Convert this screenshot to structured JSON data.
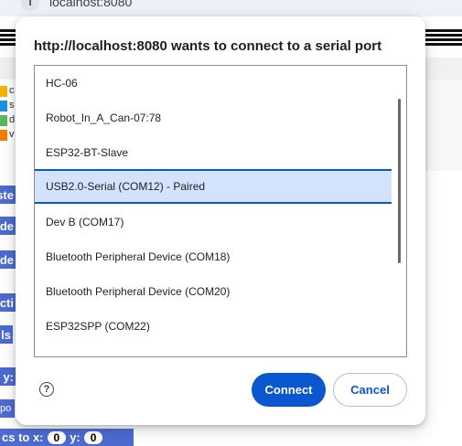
{
  "browser": {
    "address": "localhost:8080",
    "info_icon": "info-icon"
  },
  "background": {
    "legend": [
      {
        "letter": "c",
        "color": "#f4b400"
      },
      {
        "letter": "s",
        "color": "#1e90e0"
      },
      {
        "letter": "d",
        "color": "#5cb85c"
      },
      {
        "letter": "v",
        "color": "#f57c00"
      }
    ],
    "blocks": [
      "ste",
      "de",
      "de",
      "cti",
      "ls",
      "y:",
      "po"
    ],
    "bottom_block": {
      "label": "cs to x:",
      "x_value": "0",
      "y_label": "y:",
      "y_value": "0"
    },
    "block_color": "#4c6bd3"
  },
  "dialog": {
    "title": "http://localhost:8080 wants to connect to a serial port",
    "ports": [
      {
        "label": "HC-06",
        "selected": false
      },
      {
        "label": "Robot_In_A_Can-07:78",
        "selected": false
      },
      {
        "label": "ESP32-BT-Slave",
        "selected": false
      },
      {
        "label": "USB2.0-Serial (COM12) - Paired",
        "selected": true
      },
      {
        "label": "Dev B (COM17)",
        "selected": false
      },
      {
        "label": "Bluetooth Peripheral Device (COM18)",
        "selected": false
      },
      {
        "label": "Bluetooth Peripheral Device (COM20)",
        "selected": false
      },
      {
        "label": "ESP32SPP (COM22)",
        "selected": false
      }
    ],
    "help_icon": "help-circle-icon",
    "help_glyph": "?",
    "connect_label": "Connect",
    "cancel_label": "Cancel",
    "accent_color": "#0b57d0",
    "selected_bg": "#d3e3fd"
  }
}
